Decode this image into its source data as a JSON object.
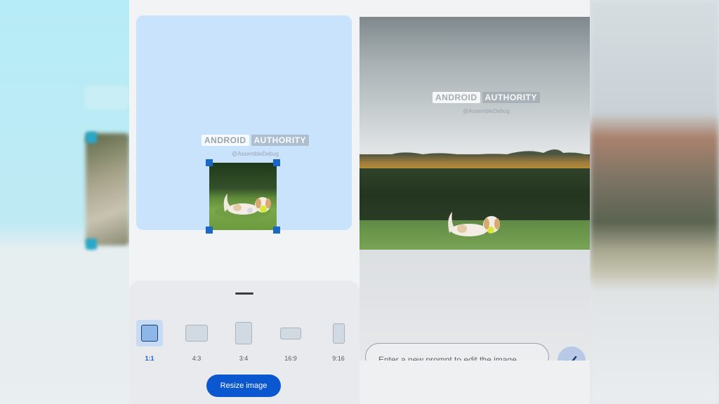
{
  "watermark": {
    "brand_part1": "ANDROID",
    "brand_part2": "AUTHORITY",
    "handle": "@AssembleDebug"
  },
  "aspect_ratios": [
    {
      "label": "1:1",
      "selected": true
    },
    {
      "label": "4:3",
      "selected": false
    },
    {
      "label": "3:4",
      "selected": false
    },
    {
      "label": "16:9",
      "selected": false
    },
    {
      "label": "9:16",
      "selected": false
    }
  ],
  "resize_button_label": "Resize image",
  "prompt": {
    "placeholder": "Enter a new prompt to edit the image"
  },
  "colors": {
    "accent": "#0b57d0",
    "selected_ratio": "#1a5fc6",
    "canvas": "#c9e3fc"
  },
  "icons": {
    "send": "checkmark-icon"
  }
}
